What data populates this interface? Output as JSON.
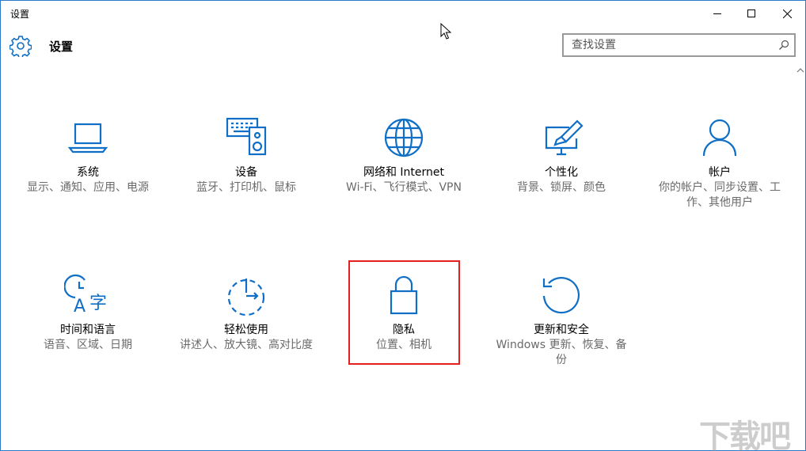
{
  "window": {
    "title": "设置"
  },
  "header": {
    "title": "设置"
  },
  "search": {
    "placeholder": "查找设置"
  },
  "tiles": [
    {
      "name": "系统",
      "desc": "显示、通知、应用、电源",
      "icon": "laptop-icon"
    },
    {
      "name": "设备",
      "desc": "蓝牙、打印机、鼠标",
      "icon": "devices-icon"
    },
    {
      "name": "网络和 Internet",
      "desc": "Wi-Fi、飞行模式、VPN",
      "icon": "globe-icon"
    },
    {
      "name": "个性化",
      "desc": "背景、锁屏、颜色",
      "icon": "personalization-icon"
    },
    {
      "name": "帐户",
      "desc": "你的帐户、同步设置、工作、其他用户",
      "icon": "person-icon"
    },
    {
      "name": "时间和语言",
      "desc": "语音、区域、日期",
      "icon": "time-language-icon"
    },
    {
      "name": "轻松使用",
      "desc": "讲述人、放大镜、高对比度",
      "icon": "ease-of-access-icon"
    },
    {
      "name": "隐私",
      "desc": "位置、相机",
      "icon": "lock-icon"
    },
    {
      "name": "更新和安全",
      "desc": "Windows 更新、恢复、备份",
      "icon": "update-icon"
    }
  ],
  "watermark": "下载吧",
  "colors": {
    "accent": "#0f6fc6",
    "highlight": "#e51f1f",
    "desc_text": "#6a6a6a"
  }
}
